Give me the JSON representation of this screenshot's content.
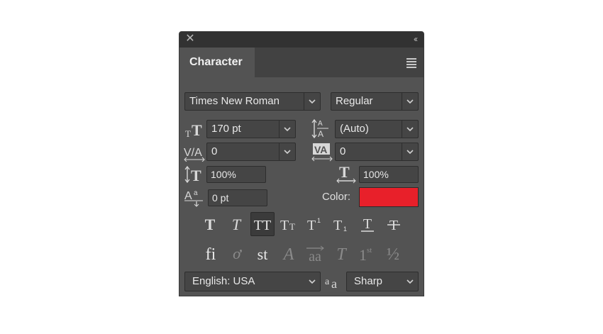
{
  "panel": {
    "tab_label": "Character",
    "colors": {
      "bg": "#535353",
      "field": "#454545",
      "swatch": "#e8202a"
    }
  },
  "icons": {
    "close": "✕",
    "collapse": "‹‹"
  },
  "font": {
    "family": "Times New Roman",
    "style": "Regular"
  },
  "metrics": {
    "size": "170 pt",
    "leading": "(Auto)",
    "kerning": "0",
    "tracking": "0",
    "vertical_scale": "100%",
    "horizontal_scale": "100%",
    "baseline_shift": "0 pt",
    "color_label": "Color:"
  },
  "style_buttons": [
    "faux-bold",
    "faux-italic",
    "all-caps",
    "small-caps",
    "superscript",
    "subscript",
    "underline",
    "strikethrough"
  ],
  "opentype_buttons": [
    "ligatures",
    "discretionary",
    "stylistic",
    "swash",
    "titling",
    "ordinals",
    "fractions"
  ],
  "glyphs": {
    "bold_T": "T",
    "italic_T": "T",
    "all_caps": "TT",
    "small_caps_big": "T",
    "small_caps_small": "T",
    "super_base": "T",
    "super_mark": "1",
    "sub_base": "T",
    "sub_mark": "1",
    "underline_T": "T",
    "strike_T": "T",
    "lig": "fi",
    "disc": "ơ",
    "styl": "st",
    "swash": "A",
    "titling": "aa",
    "titling_T": "T",
    "ord_base": "1",
    "ord_sup": "st",
    "frac": "½",
    "aa_small": "a",
    "aa_big": "a"
  },
  "footer": {
    "language": "English: USA",
    "antialias": "Sharp"
  }
}
